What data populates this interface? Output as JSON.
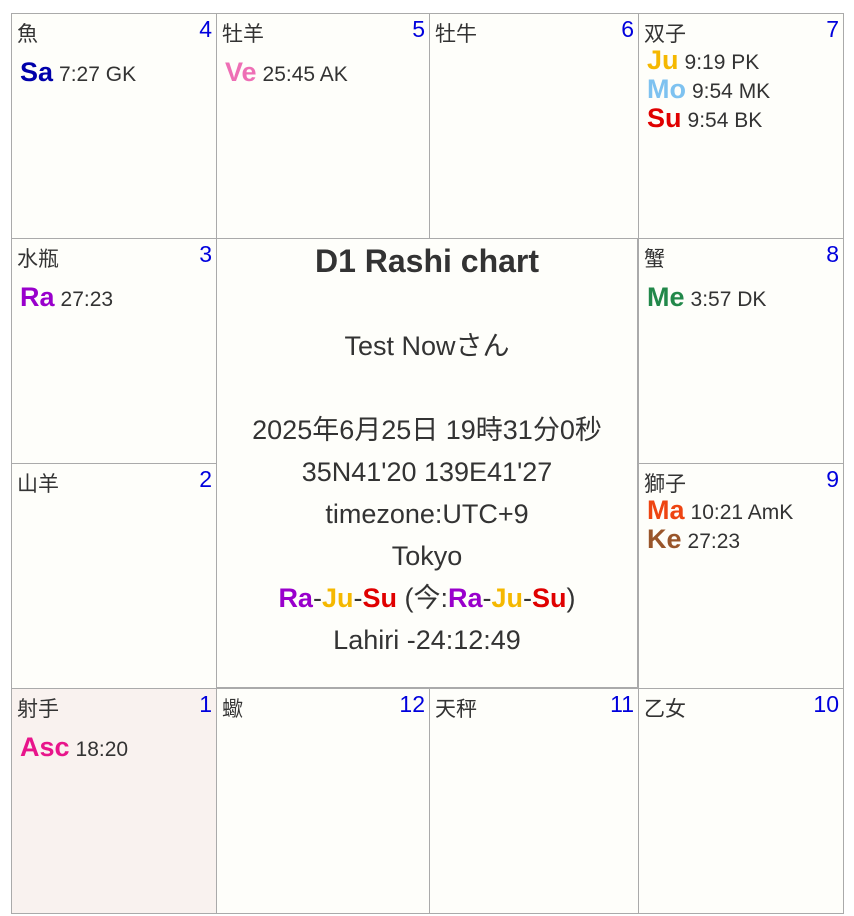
{
  "colors": {
    "Sa": "#0000aa",
    "Ve": "#ee6fb5",
    "Ju": "#f5b800",
    "Mo": "#7ec2f0",
    "Su": "#e00000",
    "Ra": "#9900cc",
    "Me": "#22884a",
    "Ma": "#ee4411",
    "Ke": "#99552a",
    "Asc": "#e8158b"
  },
  "houses": [
    {
      "id": "pisces",
      "sign": "魚",
      "num": "4",
      "planets": [
        {
          "abbr": "Sa",
          "deg": "7:27 GK"
        }
      ]
    },
    {
      "id": "aries",
      "sign": "牡羊",
      "num": "5",
      "planets": [
        {
          "abbr": "Ve",
          "deg": "25:45 AK"
        }
      ]
    },
    {
      "id": "taurus",
      "sign": "牡牛",
      "num": "6",
      "planets": []
    },
    {
      "id": "gemini",
      "sign": "双子",
      "num": "7",
      "planets": [
        {
          "abbr": "Ju",
          "deg": "9:19 PK"
        },
        {
          "abbr": "Mo",
          "deg": "9:54 MK"
        },
        {
          "abbr": "Su",
          "deg": "9:54 BK"
        }
      ]
    },
    {
      "id": "aquarius",
      "sign": "水瓶",
      "num": "3",
      "planets": [
        {
          "abbr": "Ra",
          "deg": "27:23"
        }
      ]
    },
    {
      "id": "cancer",
      "sign": "蟹",
      "num": "8",
      "planets": [
        {
          "abbr": "Me",
          "deg": "3:57 DK"
        }
      ]
    },
    {
      "id": "capricorn",
      "sign": "山羊",
      "num": "2",
      "planets": []
    },
    {
      "id": "leo",
      "sign": "獅子",
      "num": "9",
      "planets": [
        {
          "abbr": "Ma",
          "deg": "10:21 AmK"
        },
        {
          "abbr": "Ke",
          "deg": "27:23"
        }
      ]
    },
    {
      "id": "sagittarius",
      "sign": "射手",
      "num": "1",
      "planets": [
        {
          "abbr": "Asc",
          "deg": "18:20"
        }
      ]
    },
    {
      "id": "scorpio",
      "sign": "蠍",
      "num": "12",
      "planets": []
    },
    {
      "id": "libra",
      "sign": "天秤",
      "num": "11",
      "planets": []
    },
    {
      "id": "virgo",
      "sign": "乙女",
      "num": "10",
      "planets": []
    }
  ],
  "center": {
    "title": "D1 Rashi chart",
    "name": "Test Nowさん",
    "datetime": "2025年6月25日 19時31分0秒",
    "coords": "35N41'20 139E41'27",
    "timezone": "timezone:UTC+9",
    "place": "Tokyo",
    "dasha": [
      "Ra",
      "Ju",
      "Su"
    ],
    "dasha_now_label": "今:",
    "dasha_now": [
      "Ra",
      "Ju",
      "Su"
    ],
    "ayanamsa": "Lahiri -24:12:49"
  }
}
